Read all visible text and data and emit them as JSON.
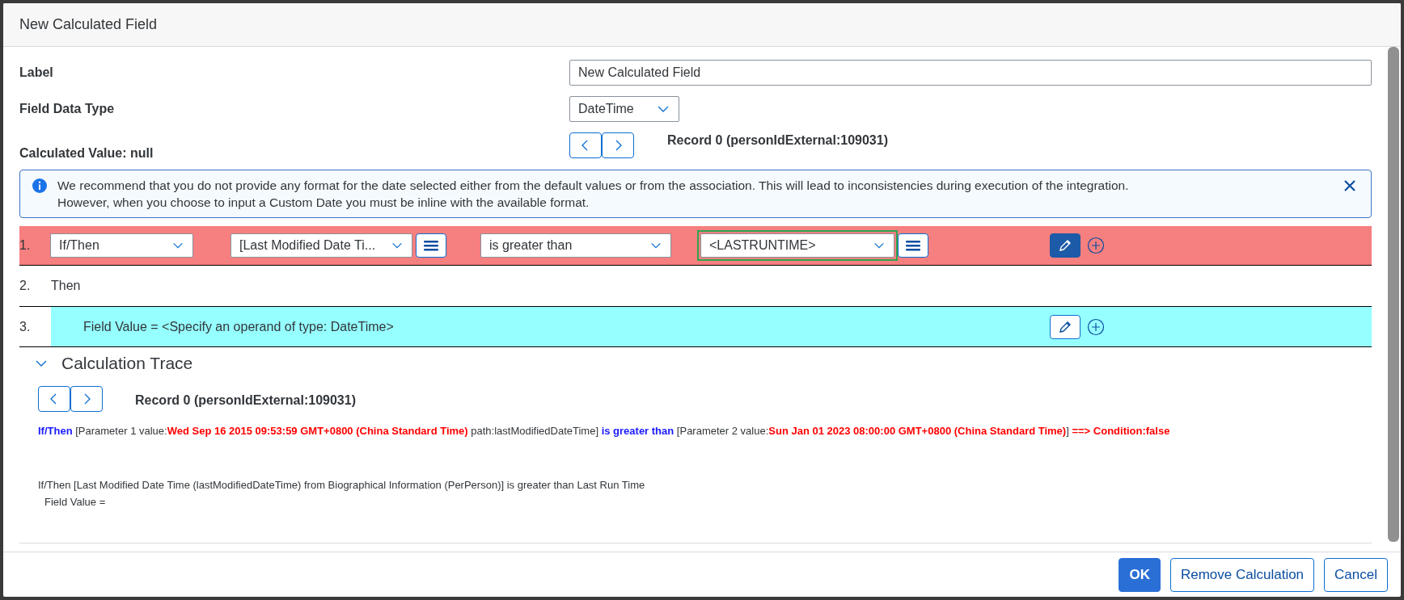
{
  "dialog": {
    "title": "New Calculated Field"
  },
  "form": {
    "label": {
      "caption": "Label",
      "value": "New Calculated Field"
    },
    "data_type": {
      "caption": "Field Data Type",
      "value": "DateTime"
    },
    "calculated_value": {
      "caption": "Calculated Value: null",
      "record": "Record 0 (personIdExternal:109031)"
    }
  },
  "info": {
    "lines": [
      "We recommend that you do not provide any format for the date selected either from the default values or from the association. This will lead to inconsistencies during execution of the integration.",
      "However, when you choose to input a Custom Date you must be inline with the available format."
    ]
  },
  "rules": [
    {
      "number": "1.",
      "color": "#f67f7f",
      "selected": true,
      "fields": [
        {
          "kind": "select",
          "value": "If/Then",
          "highlighted": false
        },
        {
          "kind": "select",
          "value": "[Last Modified Date Ti...",
          "highlighted": false
        },
        {
          "kind": "menu"
        },
        {
          "kind": "select",
          "value": "is greater than",
          "highlighted": false
        },
        {
          "kind": "select",
          "value": "<LASTRUNTIME>",
          "highlighted": true
        },
        {
          "kind": "menu"
        }
      ]
    },
    {
      "number": "2.",
      "text": "Then"
    },
    {
      "number": "3.",
      "color": "#96ffff",
      "selected": false,
      "text": "Field Value = <Specify an operand of type: DateTime>"
    }
  ],
  "trace": {
    "title": "Calculation Trace",
    "expanded": true,
    "record": "Record 0 (personIdExternal:109031)",
    "segments": [
      {
        "kind": "keyword",
        "text": "If/Then"
      },
      {
        "kind": "plain",
        "text": " [Parameter 1 value:"
      },
      {
        "kind": "value",
        "text": "Wed Sep 16 2015 09:53:59 GMT+0800 (China Standard Time)"
      },
      {
        "kind": "plain",
        "text": " path:lastModifiedDateTime] "
      },
      {
        "kind": "keyword",
        "text": "is greater than"
      },
      {
        "kind": "plain",
        "text": " [Parameter 2 value:"
      },
      {
        "kind": "value",
        "text": "Sun Jan 01 2023 08:00:00 GMT+0800 (China Standard Time)"
      },
      {
        "kind": "plain",
        "text": "] "
      },
      {
        "kind": "value",
        "text": "==> Condition:false"
      }
    ],
    "summary": [
      "If/Then [Last Modified Date Time (lastModifiedDateTime) from Biographical Information (PerPerson)] is greater than Last Run Time",
      "Field Value ="
    ]
  },
  "buttons": [
    {
      "label": "OK",
      "kind": "primary"
    },
    {
      "label": "Remove Calculation",
      "kind": "secondary"
    },
    {
      "label": "Cancel",
      "kind": "secondary"
    }
  ]
}
